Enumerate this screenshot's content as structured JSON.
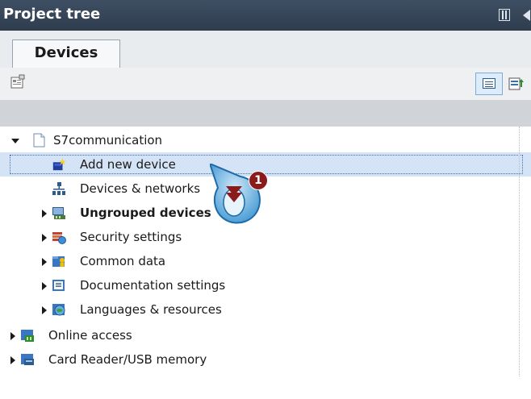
{
  "window": {
    "title": "Project tree"
  },
  "tabs": [
    {
      "label": "Devices",
      "active": true
    }
  ],
  "tree": {
    "rows": [
      {
        "label": "S7communication",
        "level": 0,
        "expanded": true,
        "bold": false,
        "icon": "project-icon"
      },
      {
        "label": "Add new device",
        "level": 1,
        "selected": true,
        "icon": "add-device-icon"
      },
      {
        "label": "Devices & networks",
        "level": 1,
        "icon": "network-icon"
      },
      {
        "label": "Ungrouped devices",
        "level": 1,
        "collapsed": true,
        "bold": true,
        "icon": "ungrouped-devices-icon"
      },
      {
        "label": "Security settings",
        "level": 1,
        "collapsed": true,
        "icon": "security-icon"
      },
      {
        "label": "Common data",
        "level": 1,
        "collapsed": true,
        "icon": "common-data-icon"
      },
      {
        "label": "Documentation settings",
        "level": 1,
        "collapsed": true,
        "icon": "documentation-icon"
      },
      {
        "label": "Languages & resources",
        "level": 1,
        "collapsed": true,
        "icon": "languages-icon"
      },
      {
        "label": "Online access",
        "level": 0,
        "collapsed": true,
        "icon": "online-access-icon"
      },
      {
        "label": "Card Reader/USB memory",
        "level": 0,
        "collapsed": true,
        "icon": "card-reader-icon"
      }
    ]
  },
  "callout": {
    "step": "1"
  },
  "colors": {
    "titlebar": "#2e3c4e",
    "selection": "#d4e3f5",
    "badge": "#8b1a1a"
  }
}
